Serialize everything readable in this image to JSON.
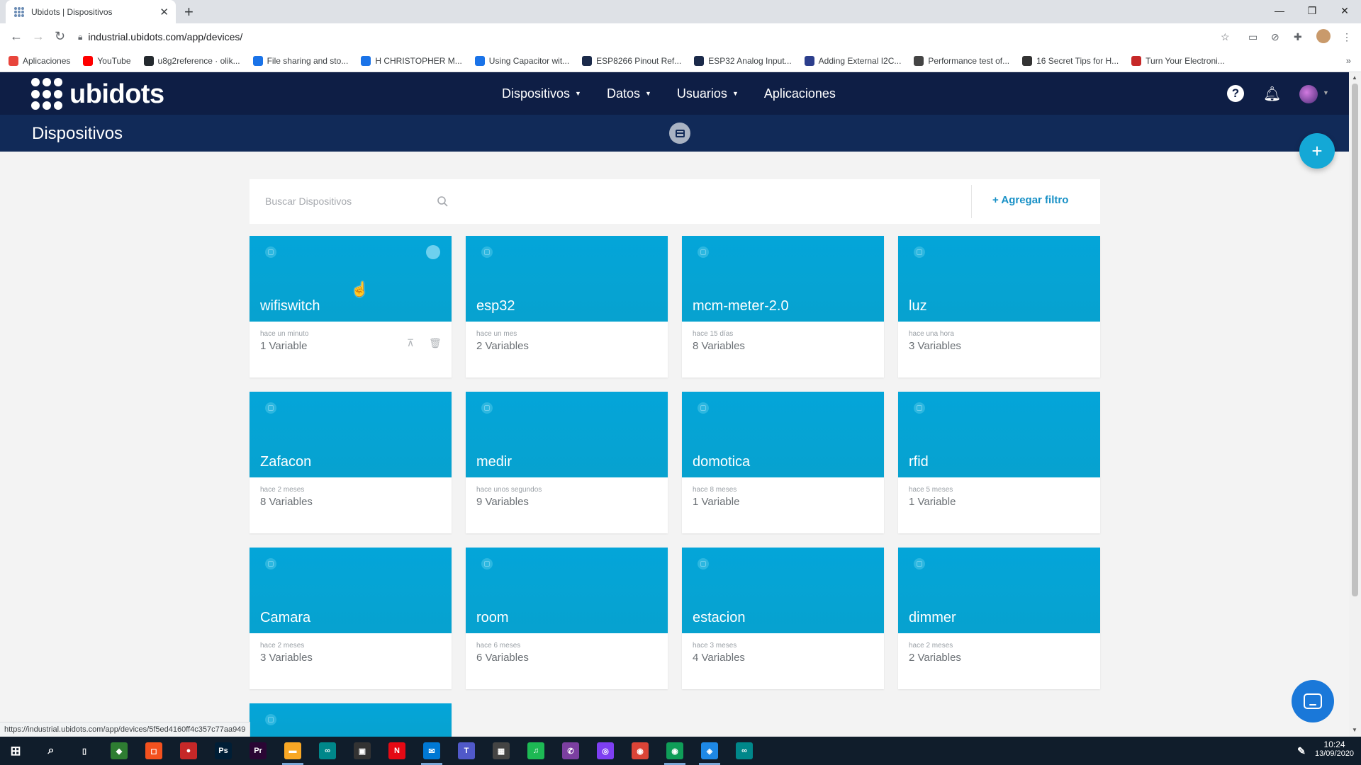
{
  "browser": {
    "tab_title": "Ubidots | Dispositivos",
    "url": "industrial.ubidots.com/app/devices/",
    "bookmarks": [
      {
        "label": "Aplicaciones",
        "color": "#e8453c"
      },
      {
        "label": "YouTube",
        "color": "#ff0000"
      },
      {
        "label": "u8g2reference · olik...",
        "color": "#24292e"
      },
      {
        "label": "File sharing and sto...",
        "color": "#1a73e8"
      },
      {
        "label": "H CHRISTOPHER M...",
        "color": "#1a73e8"
      },
      {
        "label": "Using Capacitor wit...",
        "color": "#1a73e8"
      },
      {
        "label": "ESP8266 Pinout Ref...",
        "color": "#1b2a4a"
      },
      {
        "label": "ESP32 Analog Input...",
        "color": "#1b2a4a"
      },
      {
        "label": "Adding External I2C...",
        "color": "#2c3e8c"
      },
      {
        "label": "Performance test of...",
        "color": "#444444"
      },
      {
        "label": "16 Secret Tips for H...",
        "color": "#333333"
      },
      {
        "label": "Turn Your Electroni...",
        "color": "#c62828"
      }
    ],
    "status_url": "https://industrial.ubidots.com/app/devices/5f5ed4160ff4c357c77aa949"
  },
  "app": {
    "logo_text": "ubidots",
    "nav": [
      "Dispositivos",
      "Datos",
      "Usuarios",
      "Aplicaciones"
    ],
    "page_title": "Dispositivos",
    "search_placeholder": "Buscar Dispositivos",
    "filter_label": "+ Agregar filtro",
    "fab_label": "+"
  },
  "devices": [
    {
      "name": "wifiswitch",
      "time": "hace un minuto",
      "vars": "1 Variable"
    },
    {
      "name": "esp32",
      "time": "hace un mes",
      "vars": "2 Variables"
    },
    {
      "name": "mcm-meter-2.0",
      "time": "hace 15 días",
      "vars": "8 Variables"
    },
    {
      "name": "luz",
      "time": "hace una hora",
      "vars": "3 Variables"
    },
    {
      "name": "Zafacon",
      "time": "hace 2 meses",
      "vars": "8 Variables"
    },
    {
      "name": "medir",
      "time": "hace unos segundos",
      "vars": "9 Variables"
    },
    {
      "name": "domotica",
      "time": "hace 8 meses",
      "vars": "1 Variable"
    },
    {
      "name": "rfid",
      "time": "hace 5 meses",
      "vars": "1 Variable"
    },
    {
      "name": "Camara",
      "time": "hace 2 meses",
      "vars": "3 Variables"
    },
    {
      "name": "room",
      "time": "hace 6 meses",
      "vars": "6 Variables"
    },
    {
      "name": "estacion",
      "time": "hace 3 meses",
      "vars": "4 Variables"
    },
    {
      "name": "dimmer",
      "time": "hace 2 meses",
      "vars": "2 Variables"
    }
  ],
  "taskbar": {
    "time": "10:24",
    "date": "13/09/2020",
    "apps": [
      {
        "icon": "task-view",
        "label": "▯",
        "color": "#101d2b"
      },
      {
        "icon": "app-green",
        "label": "◆",
        "color": "#2e7d32"
      },
      {
        "icon": "app-orange",
        "label": "◻",
        "color": "#f4511e"
      },
      {
        "icon": "app-red",
        "label": "●",
        "color": "#c62828"
      },
      {
        "icon": "photoshop",
        "label": "Ps",
        "color": "#001e36"
      },
      {
        "icon": "premiere",
        "label": "Pr",
        "color": "#2a0634"
      },
      {
        "icon": "file-explorer",
        "label": "▬",
        "color": "#f9a825"
      },
      {
        "icon": "arduino",
        "label": "∞",
        "color": "#00878a"
      },
      {
        "icon": "store",
        "label": "▣",
        "color": "#333333"
      },
      {
        "icon": "netflix",
        "label": "N",
        "color": "#e50914"
      },
      {
        "icon": "mail",
        "label": "✉",
        "color": "#0078d4"
      },
      {
        "icon": "teams",
        "label": "T",
        "color": "#5059c9"
      },
      {
        "icon": "app-box",
        "label": "▦",
        "color": "#444444"
      },
      {
        "icon": "spotify",
        "label": "♫",
        "color": "#1db954"
      },
      {
        "icon": "whatsapp",
        "label": "✆",
        "color": "#7b3fa0"
      },
      {
        "icon": "app-camera",
        "label": "◎",
        "color": "#7e3ff2"
      },
      {
        "icon": "chrome",
        "label": "◉",
        "color": "#db4437"
      },
      {
        "icon": "chrome-profile",
        "label": "◉",
        "color": "#0f9d58"
      },
      {
        "icon": "app-blue",
        "label": "◈",
        "color": "#1e88e5"
      },
      {
        "icon": "arduino-2",
        "label": "∞",
        "color": "#00878a"
      }
    ]
  }
}
